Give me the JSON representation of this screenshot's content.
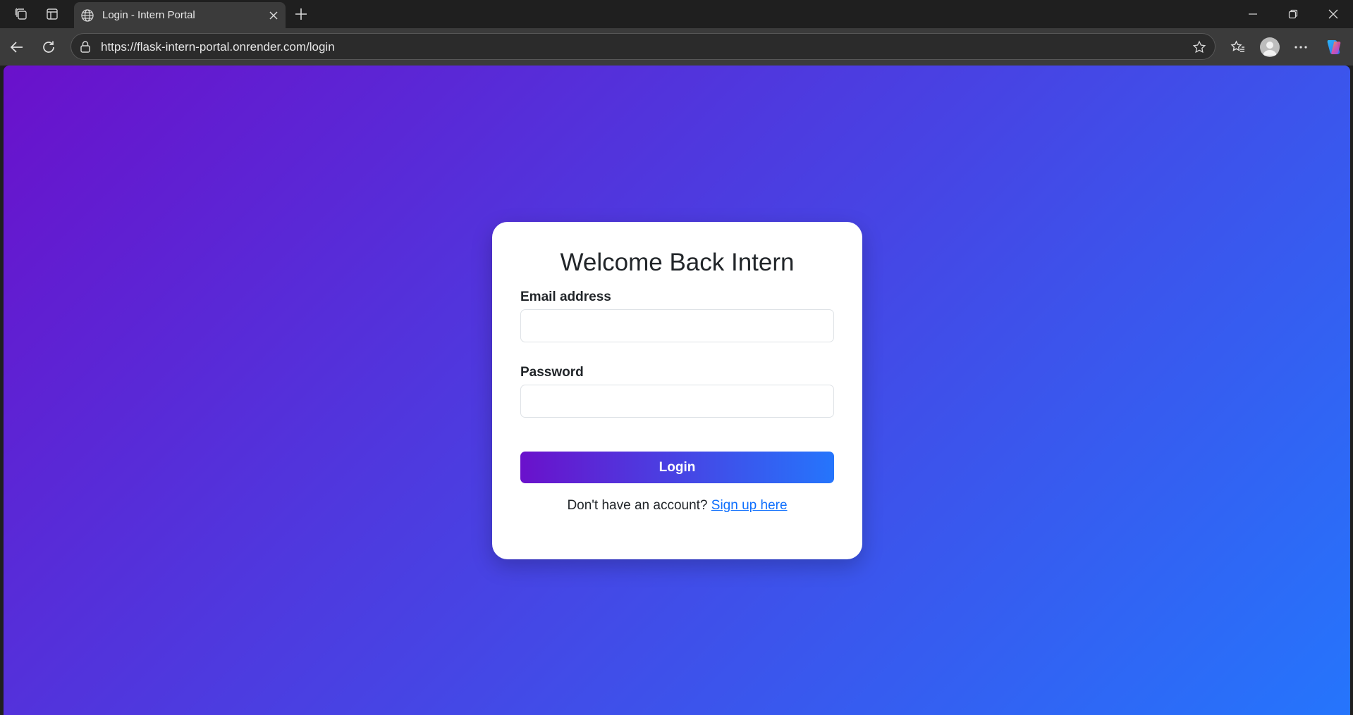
{
  "browser": {
    "tab": {
      "title": "Login - Intern Portal"
    },
    "address_bar": {
      "url": "https://flask-intern-portal.onrender.com/login"
    }
  },
  "page": {
    "background_gradient": [
      "#6a11cb",
      "#2575fc"
    ],
    "card": {
      "title": "Welcome Back Intern",
      "email": {
        "label": "Email address",
        "value": "",
        "placeholder": ""
      },
      "password": {
        "label": "Password",
        "value": "",
        "placeholder": ""
      },
      "login_button": "Login",
      "signup": {
        "prompt": "Don't have an account?",
        "link_text": "Sign up here",
        "link_color": "#0d6efd"
      }
    }
  }
}
